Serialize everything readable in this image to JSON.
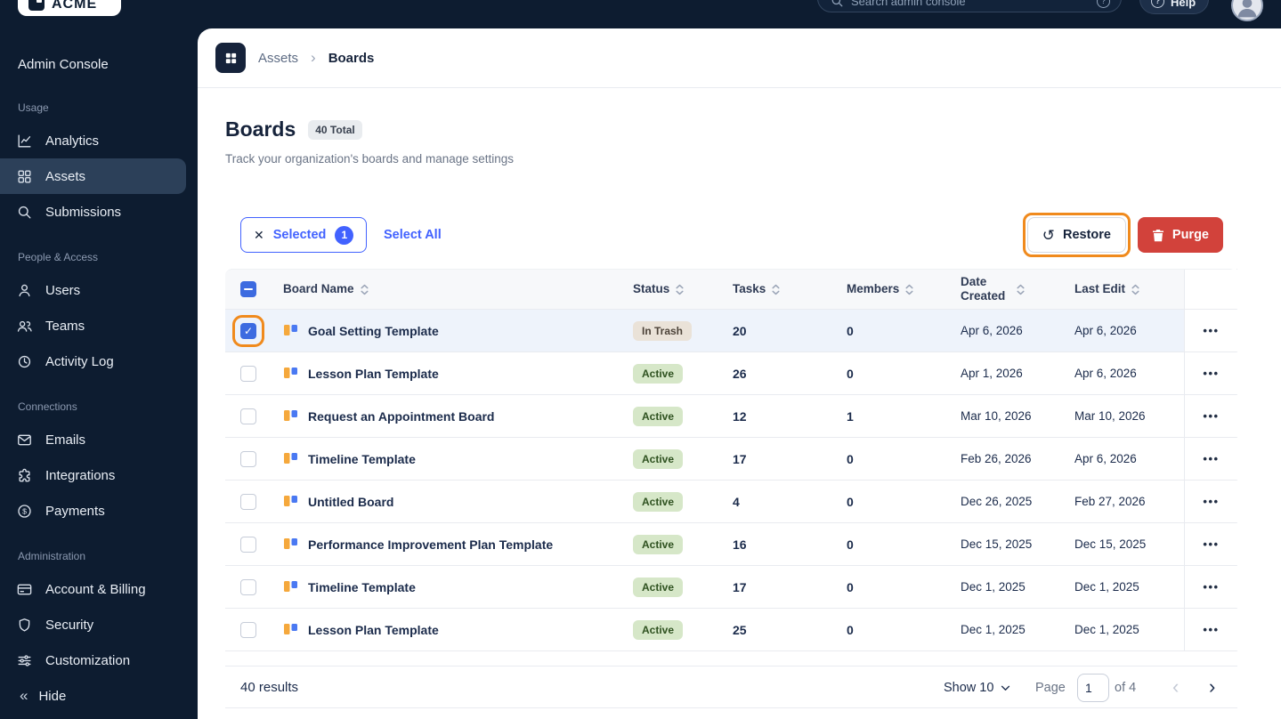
{
  "topbar": {
    "search_placeholder": "Search admin console",
    "help_label": "Help"
  },
  "sidebar": {
    "logo_text": "ACME",
    "title": "Admin Console",
    "hide_label": "Hide",
    "sections": [
      {
        "label": "Usage",
        "items": [
          {
            "label": "Analytics"
          },
          {
            "label": "Assets"
          },
          {
            "label": "Submissions"
          }
        ]
      },
      {
        "label": "People & Access",
        "items": [
          {
            "label": "Users"
          },
          {
            "label": "Teams"
          },
          {
            "label": "Activity Log"
          }
        ]
      },
      {
        "label": "Connections",
        "items": [
          {
            "label": "Emails"
          },
          {
            "label": "Integrations"
          },
          {
            "label": "Payments"
          }
        ]
      },
      {
        "label": "Administration",
        "items": [
          {
            "label": "Account & Billing"
          },
          {
            "label": "Security"
          },
          {
            "label": "Customization"
          }
        ]
      }
    ]
  },
  "breadcrumb": {
    "parent": "Assets",
    "current": "Boards"
  },
  "page": {
    "title": "Boards",
    "total_badge": "40 Total",
    "subtitle": "Track your organization's boards and manage settings"
  },
  "toolbar": {
    "selected_label": "Selected",
    "selected_count": "1",
    "select_all_label": "Select All",
    "restore_label": "Restore",
    "purge_label": "Purge"
  },
  "table": {
    "headers": [
      "Board Name",
      "Status",
      "Tasks",
      "Members",
      "Date Created",
      "Last Edit"
    ],
    "rows": [
      {
        "name": "Goal Setting Template",
        "status": "In Trash",
        "tasks": "20",
        "members": "0",
        "created": "Apr 6, 2026",
        "edited": "Apr 6, 2026",
        "checked": true
      },
      {
        "name": "Lesson Plan Template",
        "status": "Active",
        "tasks": "26",
        "members": "0",
        "created": "Apr 1, 2026",
        "edited": "Apr 6, 2026",
        "checked": false
      },
      {
        "name": "Request an Appointment Board",
        "status": "Active",
        "tasks": "12",
        "members": "1",
        "created": "Mar 10, 2026",
        "edited": "Mar 10, 2026",
        "checked": false
      },
      {
        "name": "Timeline Template",
        "status": "Active",
        "tasks": "17",
        "members": "0",
        "created": "Feb 26, 2026",
        "edited": "Apr 6, 2026",
        "checked": false
      },
      {
        "name": "Untitled Board",
        "status": "Active",
        "tasks": "4",
        "members": "0",
        "created": "Dec 26, 2025",
        "edited": "Feb 27, 2026",
        "checked": false
      },
      {
        "name": "Performance Improvement Plan Template",
        "status": "Active",
        "tasks": "16",
        "members": "0",
        "created": "Dec 15, 2025",
        "edited": "Dec 15, 2025",
        "checked": false
      },
      {
        "name": "Timeline Template",
        "status": "Active",
        "tasks": "17",
        "members": "0",
        "created": "Dec 1, 2025",
        "edited": "Dec 1, 2025",
        "checked": false
      },
      {
        "name": "Lesson Plan Template",
        "status": "Active",
        "tasks": "25",
        "members": "0",
        "created": "Dec 1, 2025",
        "edited": "Dec 1, 2025",
        "checked": false
      }
    ]
  },
  "footer": {
    "results": "40 results",
    "show_label": "Show 10",
    "page_label": "Page",
    "page_value": "1",
    "of_label": "of 4"
  },
  "icons": {
    "dots": "•••",
    "breadcrumb_sep": "›",
    "collapse": "«",
    "prev": "‹",
    "next": "›",
    "undo": "↺",
    "close": "✕"
  },
  "colors": {
    "accent_blue": "#4262FF",
    "highlight_orange": "#F08A1D",
    "danger_red": "#D2423B",
    "sidebar_bg": "#0D1C30",
    "badge_active_bg": "#D6E7C8",
    "badge_trash_bg": "#EAE2D8",
    "selected_row_bg": "#EEF3FB"
  }
}
